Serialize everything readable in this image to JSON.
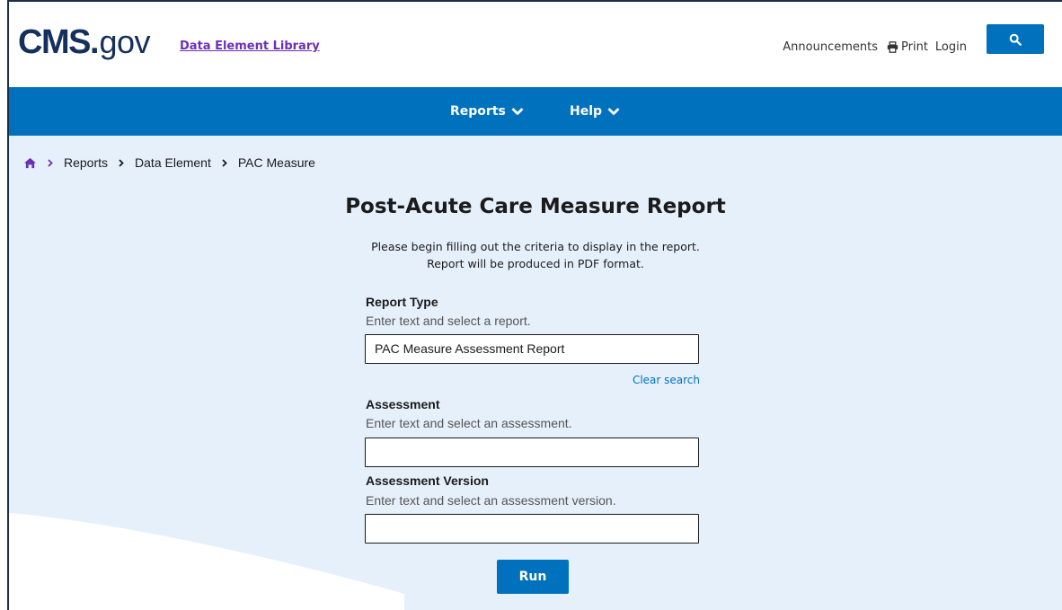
{
  "header": {
    "logo": {
      "cms": "CMS",
      "dot": ".",
      "gov": "gov"
    },
    "site_title": "Data Element Library",
    "links": {
      "announcements": "Announcements",
      "print": "Print",
      "login": "Login"
    },
    "search_icon": "search-icon"
  },
  "nav": {
    "items": [
      {
        "label": "Reports",
        "icon": "chevron-down-icon"
      },
      {
        "label": "Help",
        "icon": "chevron-down-icon"
      }
    ]
  },
  "breadcrumb": {
    "home_icon": "home-icon",
    "items": [
      "Reports",
      "Data Element",
      "PAC Measure"
    ]
  },
  "main": {
    "title": "Post-Acute Care Measure Report",
    "intro_line1": "Please begin filling out the criteria to display in the report.",
    "intro_line2": "Report will be produced in PDF format.",
    "fields": [
      {
        "label": "Report Type",
        "hint": "Enter text and select a report.",
        "value": "PAC Measure Assessment Report"
      },
      {
        "label": "Assessment",
        "hint": "Enter text and select an assessment.",
        "value": ""
      },
      {
        "label": "Assessment Version",
        "hint": "Enter text and select an assessment version.",
        "value": ""
      }
    ],
    "clear_search": "Clear search",
    "run_label": "Run"
  },
  "colors": {
    "brand_navy": "#14305c",
    "primary_blue": "#0071bc",
    "link_purple": "#6b2fb7",
    "content_bg": "#e6f0fb"
  }
}
